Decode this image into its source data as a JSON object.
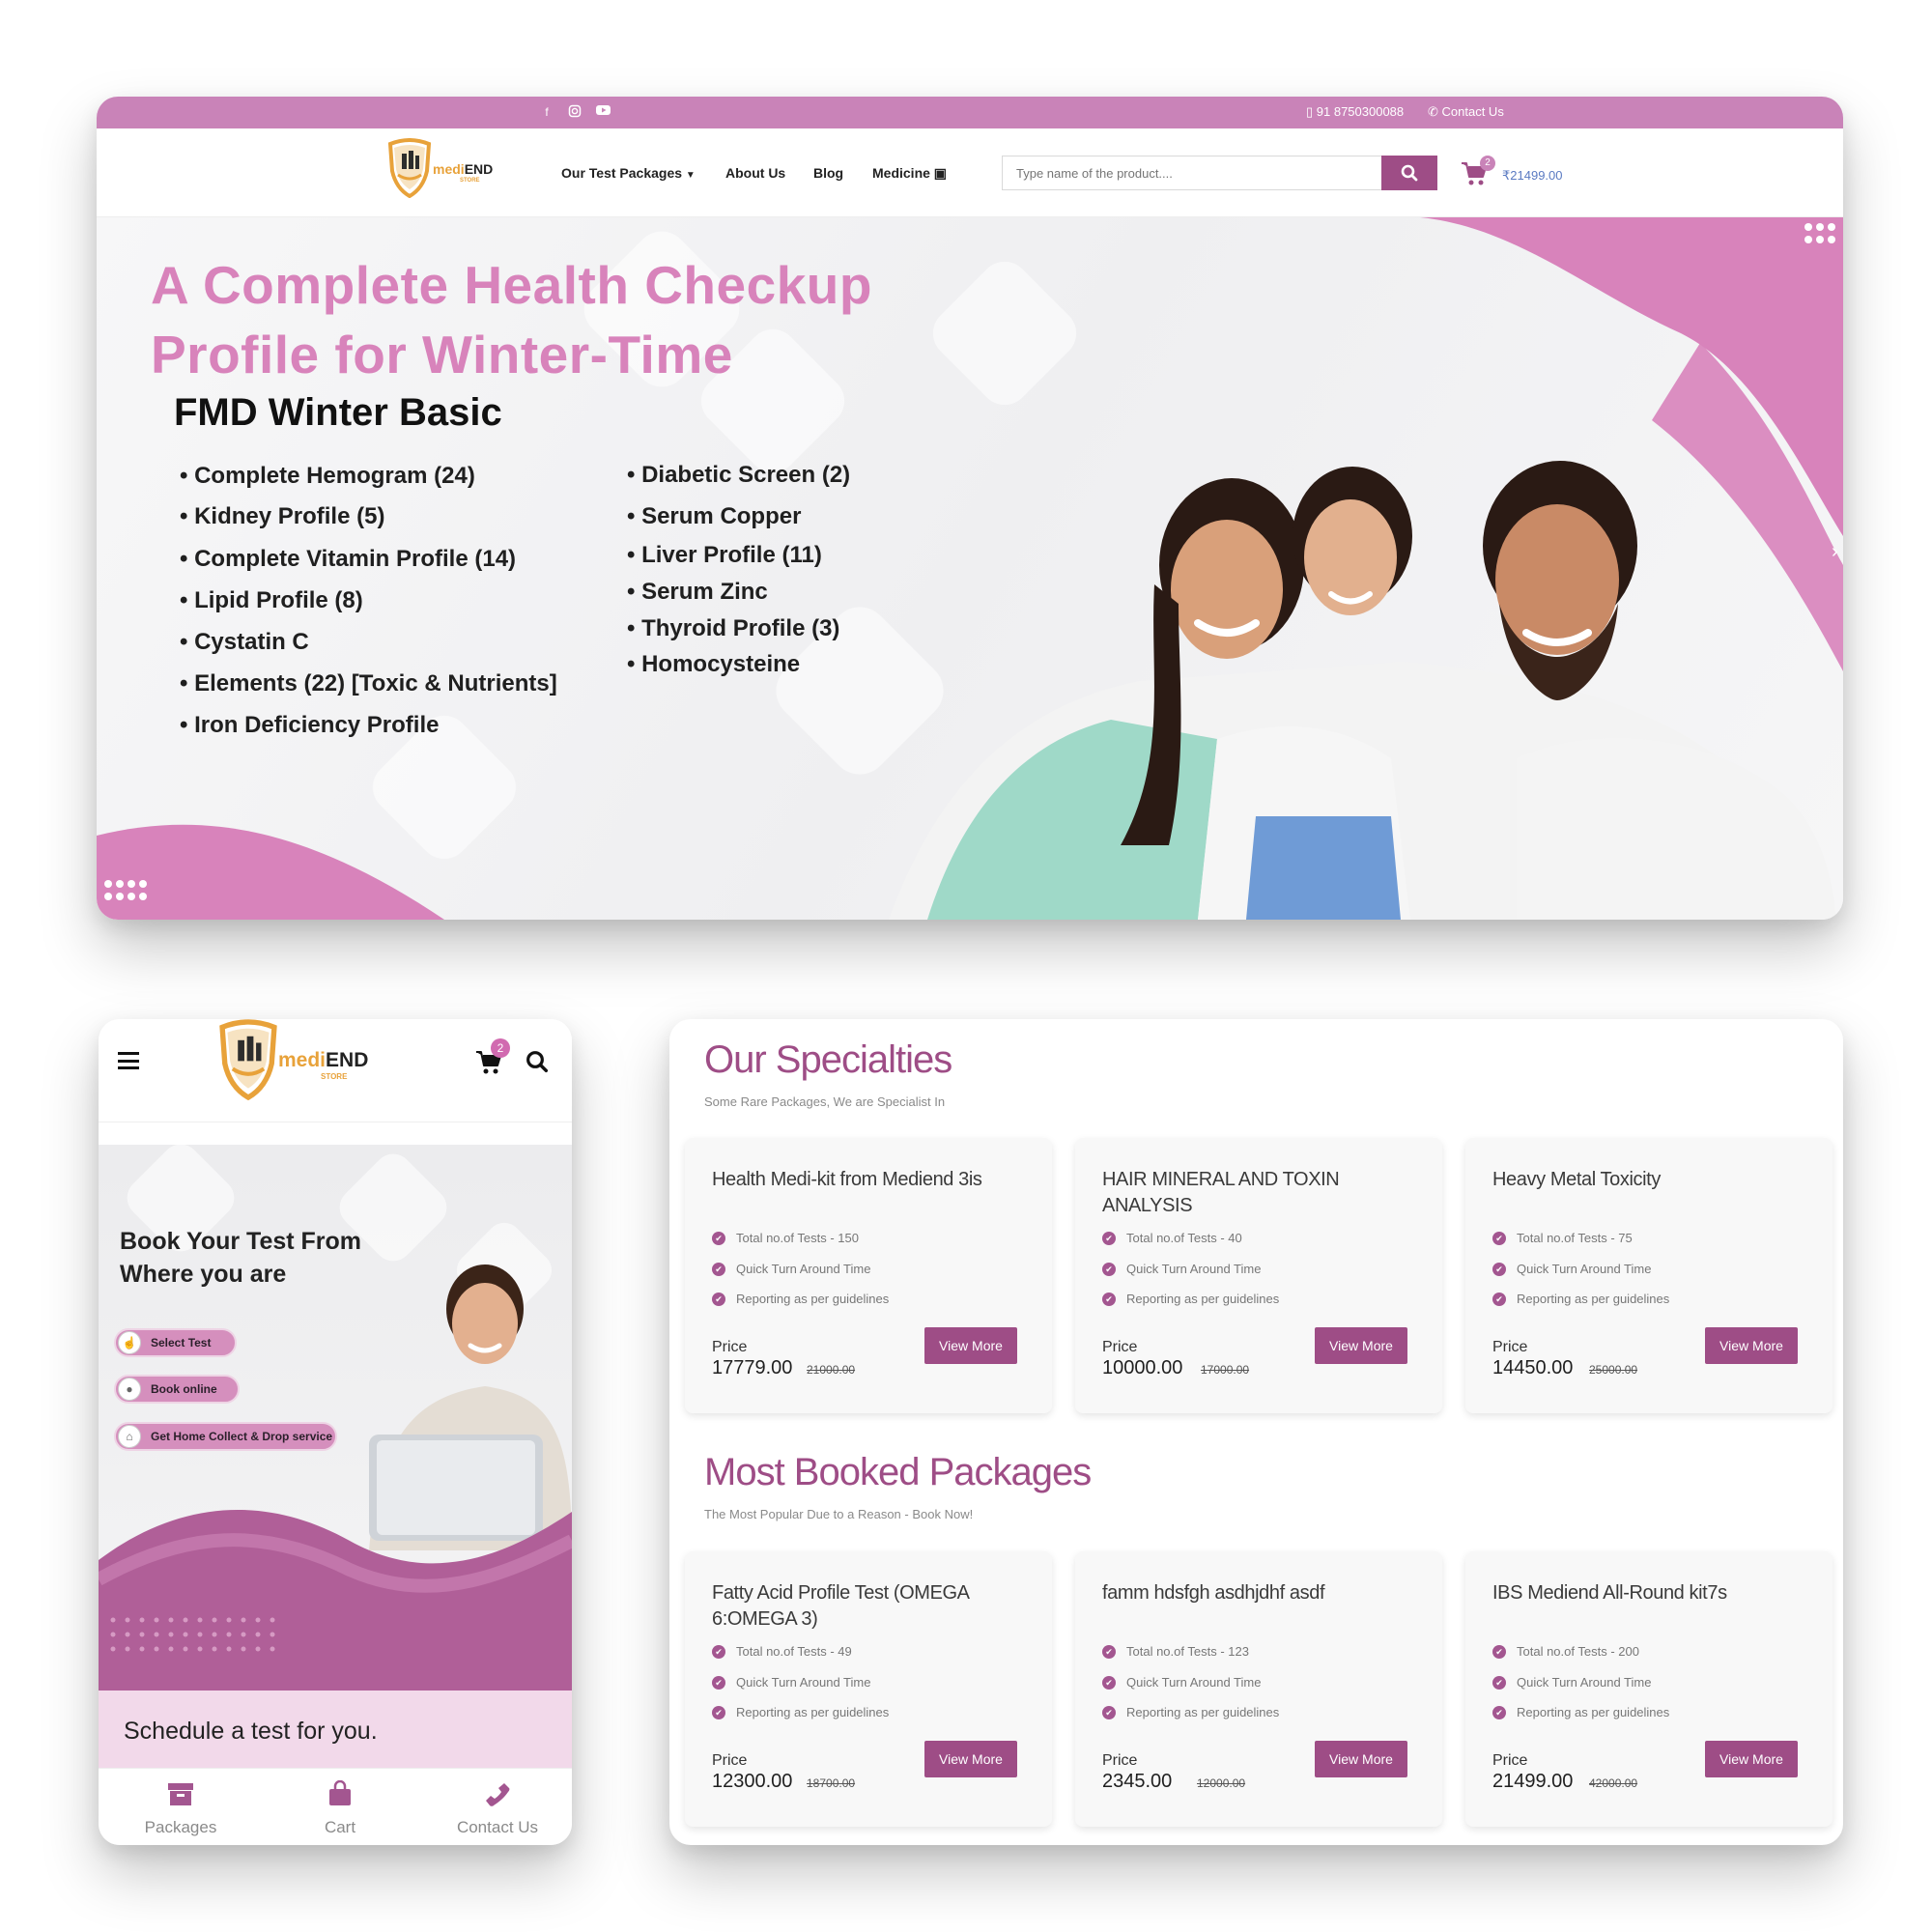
{
  "brand": {
    "name_a": "medi",
    "name_b": "END",
    "tagline": "STORE"
  },
  "desktop": {
    "topbar": {
      "phone": "91 8750300088",
      "contact": "Contact Us"
    },
    "nav": {
      "links": [
        "Our Test Packages",
        "About Us",
        "Blog",
        "Medicine"
      ],
      "search_placeholder": "Type name of the product....",
      "cart_count": "2",
      "cart_total": "₹21499.00"
    },
    "hero": {
      "title_line1": "A Complete Health Checkup",
      "title_line2": "Profile for Winter-Time",
      "package_name": "FMD Winter Basic",
      "left_items": [
        "Complete Hemogram (24)",
        "Kidney Profile (5)",
        "Complete Vitamin Profile (14)",
        "Lipid Profile (8)",
        "Cystatin C",
        "Elements (22) [Toxic & Nutrients]",
        "Iron Deficiency Profile"
      ],
      "right_items": [
        "Diabetic Screen (2)",
        "Serum Copper",
        "Liver Profile (11)",
        "Serum Zinc",
        "Thyroid Profile (3)",
        "Homocysteine"
      ]
    }
  },
  "mobile": {
    "cart_count": "2",
    "hero_line1": "Book Your Test From",
    "hero_line2": "Where you are",
    "steps": [
      "Select Test",
      "Book online",
      "Get Home Collect & Drop service"
    ],
    "schedule": "Schedule a test for you.",
    "tabs": [
      "Packages",
      "Cart",
      "Contact Us"
    ]
  },
  "specialties": {
    "title": "Our Specialties",
    "subtitle": "Some Rare Packages, We are Specialist In",
    "packages": [
      {
        "title": "Health Medi-kit from Mediend 3is",
        "tests": "Total no.of Tests - 150",
        "tat": "Quick Turn Around Time",
        "reporting": "Reporting as per guidelines",
        "price_label": "Price",
        "price": "17779.00",
        "old_price": "21000.00",
        "button": "View More"
      },
      {
        "title": "HAIR MINERAL AND TOXIN ANALYSIS",
        "tests": "Total no.of Tests - 40",
        "tat": "Quick Turn Around Time",
        "reporting": "Reporting as per guidelines",
        "price_label": "Price",
        "price": "10000.00",
        "old_price": "17000.00",
        "button": "View More"
      },
      {
        "title": "Heavy Metal Toxicity",
        "tests": "Total no.of Tests - 75",
        "tat": "Quick Turn Around Time",
        "reporting": "Reporting as per guidelines",
        "price_label": "Price",
        "price": "14450.00",
        "old_price": "25000.00",
        "button": "View More"
      }
    ]
  },
  "most_booked": {
    "title": "Most Booked Packages",
    "subtitle": "The Most Popular Due to a Reason - Book Now!",
    "packages": [
      {
        "title": "Fatty Acid Profile Test (OMEGA 6:OMEGA 3)",
        "tests": "Total no.of Tests - 49",
        "tat": "Quick Turn Around Time",
        "reporting": "Reporting as per guidelines",
        "price_label": "Price",
        "price": "12300.00",
        "old_price": "18700.00",
        "button": "View More"
      },
      {
        "title": "famm hdsfgh asdhjdhf asdf",
        "tests": "Total no.of Tests - 123",
        "tat": "Quick Turn Around Time",
        "reporting": "Reporting as per guidelines",
        "price_label": "Price",
        "price": "2345.00",
        "old_price": "12000.00",
        "button": "View More"
      },
      {
        "title": "IBS Mediend All-Round kit7s",
        "tests": "Total no.of Tests - 200",
        "tat": "Quick Turn Around Time",
        "reporting": "Reporting as per guidelines",
        "price_label": "Price",
        "price": "21499.00",
        "old_price": "42000.00",
        "button": "View More"
      }
    ]
  },
  "colors": {
    "brand_pink": "#c983b8",
    "brand_purple": "#9e4d86",
    "hero_title": "#d883bb",
    "logo_orange": "#e8a23a"
  }
}
